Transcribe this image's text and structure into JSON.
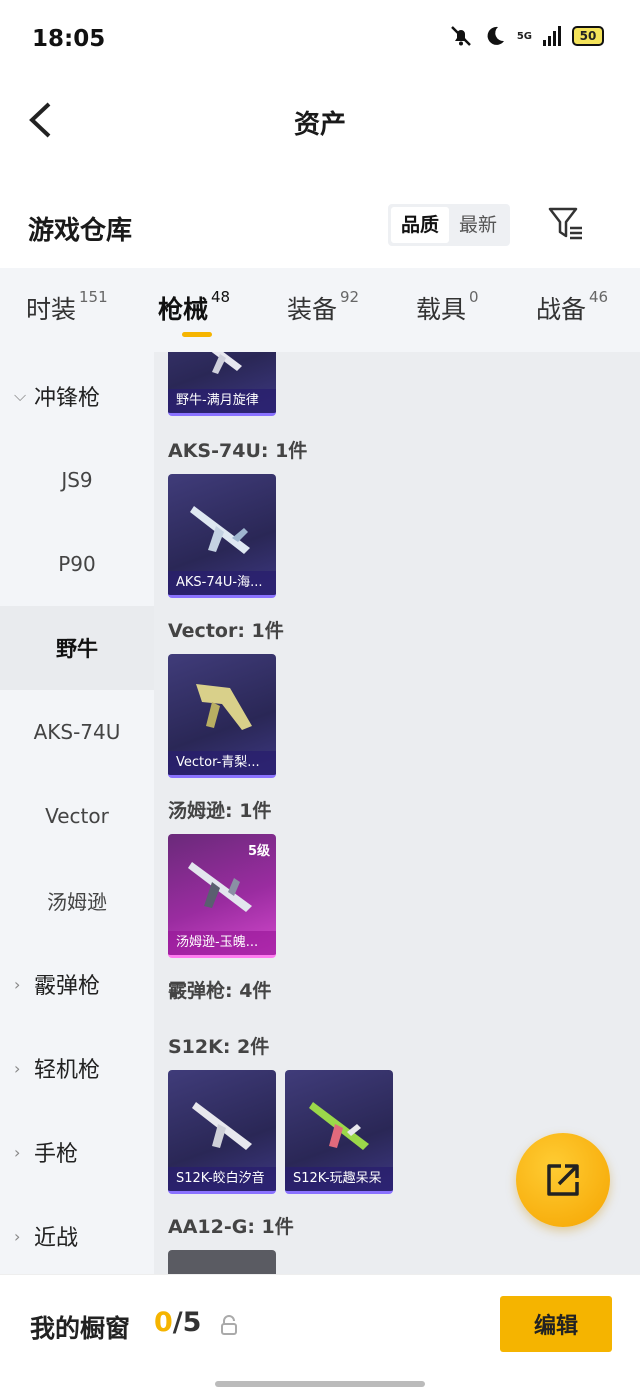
{
  "status_bar": {
    "time": "18:05",
    "network": "5G",
    "battery": "50"
  },
  "nav": {
    "title": "资产"
  },
  "section": {
    "title": "游戏仓库",
    "sort_options": [
      "品质",
      "最新"
    ]
  },
  "tabs": [
    {
      "label": "时装",
      "count": "151"
    },
    {
      "label": "枪械",
      "count": "48"
    },
    {
      "label": "装备",
      "count": "92"
    },
    {
      "label": "载具",
      "count": "0"
    },
    {
      "label": "战备",
      "count": "46"
    }
  ],
  "sidebar": {
    "categories": {
      "smg": "冲锋枪",
      "shotgun": "霰弹枪",
      "lmg": "轻机枪",
      "pistol": "手枪",
      "melee": "近战"
    },
    "items": [
      "JS9",
      "P90",
      "野牛",
      "AKS-74U",
      "Vector",
      "汤姆逊"
    ]
  },
  "content": {
    "top_card": "野牛-满月旋律",
    "groups": [
      {
        "label": "AKS-74U: 1件",
        "card": "AKS-74U-海..."
      },
      {
        "label": "Vector: 1件",
        "card": "Vector-青梨..."
      },
      {
        "label": "汤姆逊: 1件",
        "card": "汤姆逊-玉魄...",
        "level": "5级"
      }
    ],
    "shotgun_label": "霰弹枪: 4件",
    "s12k_label": "S12K: 2件",
    "s12k_cards": [
      "S12K-皎白汐音",
      "S12K-玩趣呆呆"
    ],
    "aa12_label": "AA12-G: 1件"
  },
  "bottom": {
    "showcase_label": "我的橱窗",
    "showcase_current": "0",
    "showcase_total": "/5",
    "edit_label": "编辑"
  }
}
